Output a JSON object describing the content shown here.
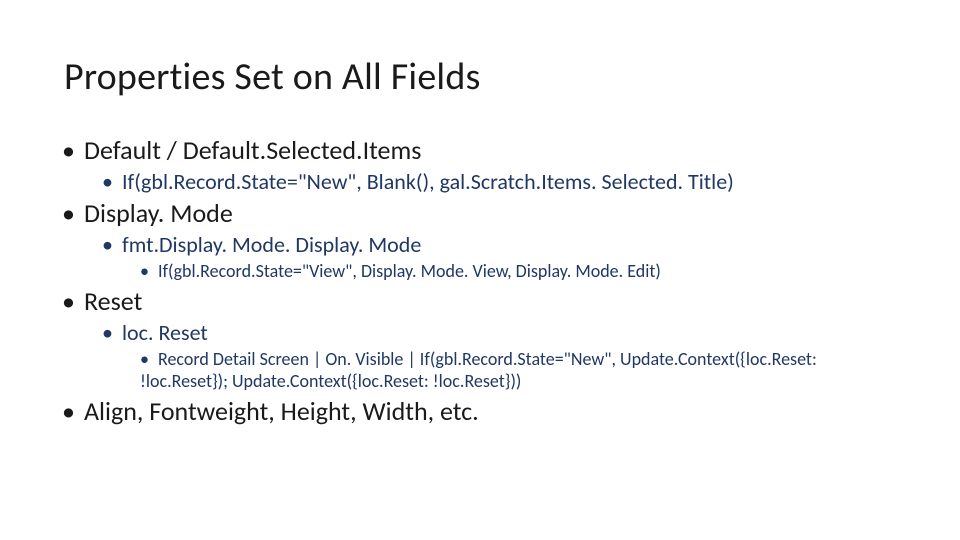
{
  "title": "Properties Set on All Fields",
  "bullets": {
    "b1": {
      "label": "Default / Default.Selected.Items"
    },
    "b1_1": {
      "label": "If(gbl.Record.State=\"New\", Blank(), gal.Scratch.Items. Selected. Title)"
    },
    "b2": {
      "label": "Display. Mode"
    },
    "b2_1": {
      "label": "fmt.Display. Mode. Display. Mode"
    },
    "b2_1_1": {
      "label": "If(gbl.Record.State=\"View\", Display. Mode. View, Display. Mode. Edit)"
    },
    "b3": {
      "label": "Reset"
    },
    "b3_1": {
      "label": "loc. Reset"
    },
    "b3_1_1": {
      "label": "Record Detail Screen | On. Visible | If(gbl.Record.State=\"New\", Update.Context({loc.Reset: !loc.Reset}); Update.Context({loc.Reset: !loc.Reset}))"
    },
    "b4": {
      "label": "Align, Fontweight, Height, Width, etc."
    }
  }
}
